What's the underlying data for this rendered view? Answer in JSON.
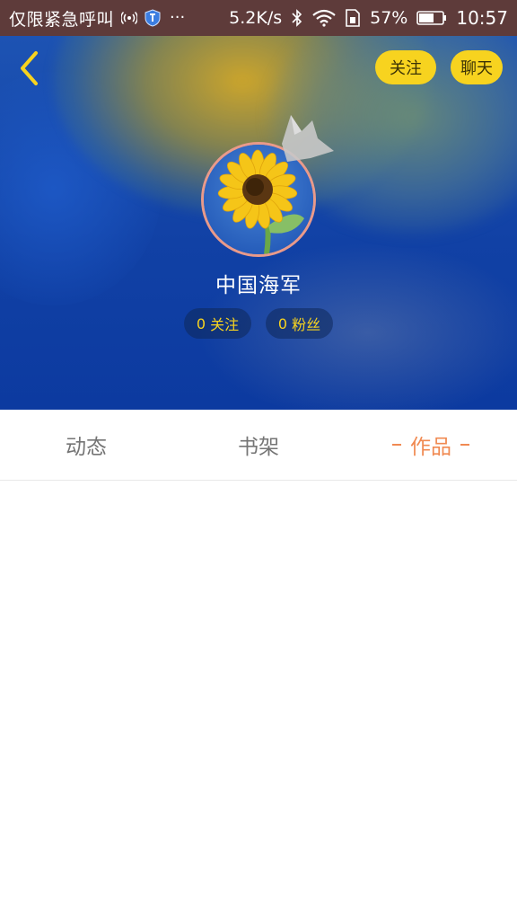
{
  "status_bar": {
    "carrier": "仅限紧急呼叫",
    "more": "···",
    "net_speed": "5.2K/s",
    "battery_pct": "57%",
    "time": "10:57",
    "background_color": "#5e3b3a"
  },
  "header": {
    "follow_label": "关注",
    "chat_label": "聊天",
    "button_color": "#f7d31f"
  },
  "profile": {
    "username": "中国海军",
    "following_count": "0",
    "following_label": "关注",
    "fans_count": "0",
    "fans_label": "粉丝",
    "avatar_icon": "sunflower-avatar",
    "badge_icon": "crown-icon"
  },
  "tabs": [
    {
      "label": "动态",
      "active": false
    },
    {
      "label": "书架",
      "active": false
    },
    {
      "label": "作品",
      "active": true
    }
  ],
  "colors": {
    "active_tab": "#f08a52",
    "inactive_tab": "#757575",
    "accent_yellow": "#f7d31f"
  }
}
